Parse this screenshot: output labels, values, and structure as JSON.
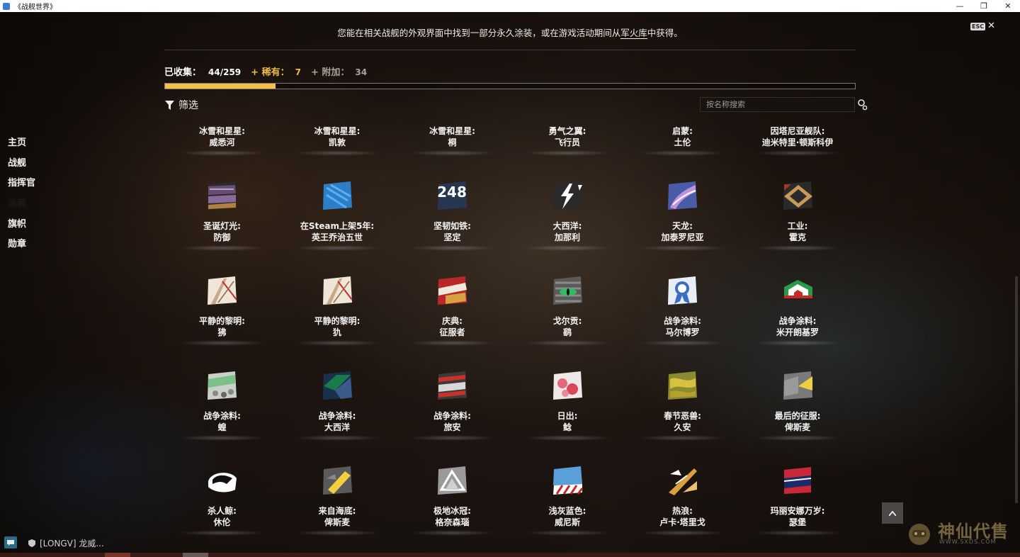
{
  "window": {
    "title": "《战舰世界》",
    "minimize": "—",
    "restore": "❐",
    "close": "✕"
  },
  "notice": {
    "before": "您能在相关战舰的外观界面中找到一部分永久涂装，或在游戏活动期间从",
    "link": "军火库",
    "after": "中获得。"
  },
  "esc": {
    "key": "ESC",
    "close": "✕"
  },
  "stats": {
    "collected_label": "已收集：",
    "collected_value": "44/259",
    "rare_label": "+ 稀有：",
    "rare_value": "7",
    "extra_label": "+ 附加：",
    "extra_value": "34",
    "progress_fraction": 0.16
  },
  "filter": {
    "label": "筛选"
  },
  "search": {
    "placeholder": "按名称搜索"
  },
  "sidebar": {
    "items": [
      {
        "label": "主页",
        "active": false
      },
      {
        "label": "战舰",
        "active": false
      },
      {
        "label": "指挥官",
        "active": false
      },
      {
        "label": "涂装",
        "active": true
      },
      {
        "label": "旗帜",
        "active": false
      },
      {
        "label": "勋章",
        "active": false
      }
    ]
  },
  "camos": [
    {
      "line1": "冰雪和星星:",
      "line2": "威悉河",
      "icon": null
    },
    {
      "line1": "冰雪和星星:",
      "line2": "凯敦",
      "icon": null
    },
    {
      "line1": "冰雪和星星:",
      "line2": "桐",
      "icon": null
    },
    {
      "line1": "勇气之翼:",
      "line2": "飞行员",
      "icon": null
    },
    {
      "line1": "启蒙:",
      "line2": "土伦",
      "icon": null
    },
    {
      "line1": "因塔尼亚舰队:",
      "line2": "迪米特里·顿斯科伊",
      "icon": null
    },
    {
      "line1": "圣诞灯光:",
      "line2": "防御",
      "icon": "purple-stripes-camo-icon"
    },
    {
      "line1": "在Steam上架5年:",
      "line2": "英王乔治五世",
      "icon": "blue-pattern-camo-icon"
    },
    {
      "line1": "坚韧如铁:",
      "line2": "坚定",
      "icon": "number-camo-icon",
      "icon_text": "248"
    },
    {
      "line1": "大西洋:",
      "line2": "加那利",
      "icon": "lightning-camo-icon"
    },
    {
      "line1": "天龙:",
      "line2": "加泰罗尼亚",
      "icon": "dragon-camo-icon"
    },
    {
      "line1": "工业:",
      "line2": "霍克",
      "icon": "industrial-camo-icon"
    },
    {
      "line1": "平静的黎明:",
      "line2": "狒",
      "icon": "dawn-camo-icon"
    },
    {
      "line1": "平静的黎明:",
      "line2": "犰",
      "icon": "dawn-camo-icon"
    },
    {
      "line1": "庆典:",
      "line2": "征服者",
      "icon": "celebration-camo-icon"
    },
    {
      "line1": "戈尔贡:",
      "line2": "鹞",
      "icon": "gorgon-eye-camo-icon"
    },
    {
      "line1": "战争涂料:",
      "line2": "马尔博罗",
      "icon": "ribbon-camo-icon"
    },
    {
      "line1": "战争涂料:",
      "line2": "米开朗基罗",
      "icon": "tricolor-camo-icon"
    },
    {
      "line1": "战争涂料:",
      "line2": "蝗",
      "icon": "green-camo-icon"
    },
    {
      "line1": "战争涂料:",
      "line2": "大西洋",
      "icon": "teal-camo-icon"
    },
    {
      "line1": "战争涂料:",
      "line2": "旅安",
      "icon": "red-stripe-camo-icon"
    },
    {
      "line1": "日出:",
      "line2": "鲶",
      "icon": "sunrise-camo-icon"
    },
    {
      "line1": "春节恶兽:",
      "line2": "久安",
      "icon": "beast-camo-icon"
    },
    {
      "line1": "最后的征服:",
      "line2": "俾斯麦",
      "icon": "yellow-grey-camo-icon"
    },
    {
      "line1": "杀人鲸:",
      "line2": "休伦",
      "icon": "orca-camo-icon"
    },
    {
      "line1": "来自海底:",
      "line2": "俾斯麦",
      "icon": "deep-sea-camo-icon"
    },
    {
      "line1": "极地冰冠:",
      "line2": "格奈森瑙",
      "icon": "polar-camo-icon"
    },
    {
      "line1": "浅灰蓝色:",
      "line2": "威尼斯",
      "icon": "hazard-camo-icon"
    },
    {
      "line1": "热浪:",
      "line2": "卢卡·塔里戈",
      "icon": "heatwave-camo-icon"
    },
    {
      "line1": "玛丽安娜万岁:",
      "line2": "瑟堡",
      "icon": "flag-camo-icon"
    }
  ],
  "chat": {
    "line": "[LONGV] 龙威..."
  },
  "watermark": {
    "text": "神仙代售",
    "url": "WWW.SXDS.COM"
  },
  "colors": {
    "accent": "#f5c04a",
    "rare": "#f0b94a",
    "extra": "#a9a29a"
  }
}
